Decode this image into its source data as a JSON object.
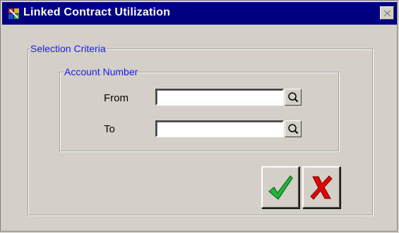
{
  "window": {
    "title": "Linked Contract Utilization",
    "close_icon": "close-icon"
  },
  "selection_criteria": {
    "legend": "Selection Criteria",
    "account_number": {
      "legend": "Account Number",
      "from_label": "From",
      "from_value": "",
      "to_label": "To",
      "to_value": "",
      "lookup_icon": "magnifier-icon"
    }
  },
  "actions": {
    "ok_icon": "checkmark-icon",
    "cancel_icon": "cross-icon",
    "ok_color": "#22b33a",
    "cancel_color": "#e00000"
  },
  "colors": {
    "titlebar": "#000080",
    "legend_text": "#1a1aff",
    "face": "#d4d0c8"
  }
}
